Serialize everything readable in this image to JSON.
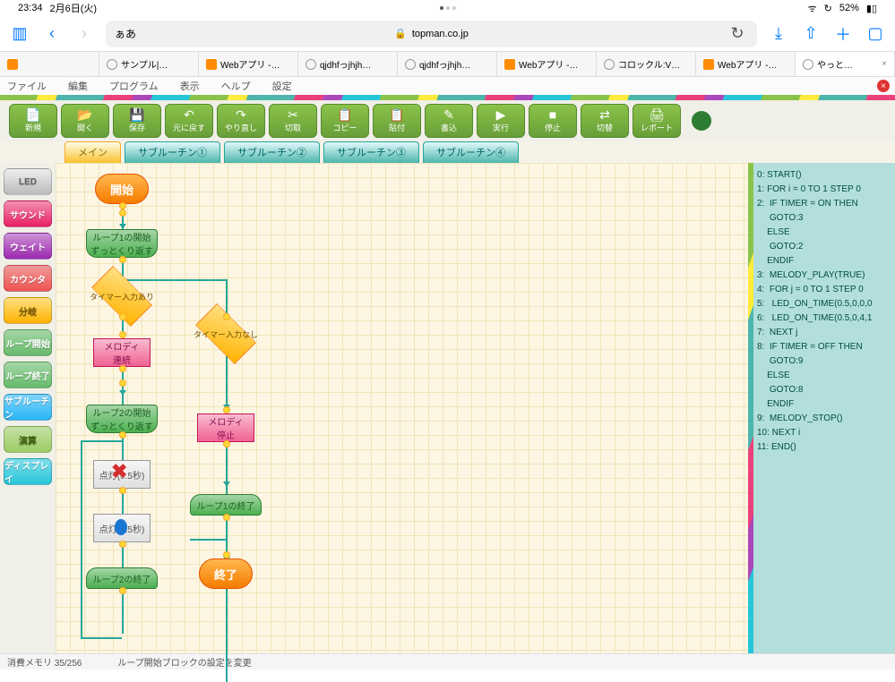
{
  "status": {
    "time": "23:34",
    "date": "2月6日(火)",
    "battery": "52%"
  },
  "safari": {
    "url_left": "ぁあ",
    "domain": "topman.co.jp"
  },
  "browser_tabs": [
    {
      "label": ""
    },
    {
      "label": "サンプル|…"
    },
    {
      "label": "Webアプリ -…"
    },
    {
      "label": "qjdhfっjhjh…"
    },
    {
      "label": "qjdhfっjhjh…"
    },
    {
      "label": "Webアプリ -…"
    },
    {
      "label": "コロックル:V…"
    },
    {
      "label": "Webアプリ -…"
    },
    {
      "label": "やっと…"
    }
  ],
  "menu": [
    "ファイル",
    "編集",
    "プログラム",
    "表示",
    "ヘルプ",
    "設定"
  ],
  "toolbar": [
    {
      "icon": "📄",
      "label": "新規"
    },
    {
      "icon": "📂",
      "label": "開く"
    },
    {
      "icon": "💾",
      "label": "保存"
    },
    {
      "icon": "↶",
      "label": "元に戻す"
    },
    {
      "icon": "↷",
      "label": "やり直し"
    },
    {
      "icon": "✂",
      "label": "切取"
    },
    {
      "icon": "📋",
      "label": "コピー"
    },
    {
      "icon": "📋",
      "label": "貼付"
    },
    {
      "icon": "✎",
      "label": "書込"
    },
    {
      "icon": "▶",
      "label": "実行"
    },
    {
      "icon": "■",
      "label": "停止"
    },
    {
      "icon": "⇄",
      "label": "切替"
    },
    {
      "icon": "🖨",
      "label": "レポート"
    }
  ],
  "app_tabs": [
    "メイン",
    "サブルーチン①",
    "サブルーチン②",
    "サブルーチン③",
    "サブルーチン④"
  ],
  "palette": [
    {
      "cls": "led",
      "label": "LED"
    },
    {
      "cls": "sound",
      "label": "サウンド"
    },
    {
      "cls": "wait",
      "label": "ウェイト"
    },
    {
      "cls": "counter",
      "label": "カウンタ"
    },
    {
      "cls": "branch",
      "label": "分岐"
    },
    {
      "cls": "lstart",
      "label": "ループ開始"
    },
    {
      "cls": "lend",
      "label": "ループ終了"
    },
    {
      "cls": "subr",
      "label": "サブルーチン"
    },
    {
      "cls": "calc",
      "label": "演算"
    },
    {
      "cls": "disp",
      "label": "ディスプレイ"
    }
  ],
  "flow": {
    "start": "開始",
    "end": "終了",
    "loop1_start_l1": "ループ1の開始",
    "loop1_start_l2": "ずっとくり返す",
    "branch_yes": "タイマー入力あり",
    "branch_no": "タイマー入力なし",
    "melody_cont_l1": "メロディ",
    "melody_cont_l2": "連続",
    "loop2_start_l1": "ループ2の開始",
    "loop2_start_l2": "ずっとくり返す",
    "led_on": "点灯(0.5秒)",
    "led_on2": "点灯(0.5秒)",
    "loop2_end": "ループ2の終了",
    "melody_stop_l1": "メロディ",
    "melody_stop_l2": "停止",
    "loop1_end": "ループ1の終了"
  },
  "code": "0: START()\n1: FOR i = 0 TO 1 STEP 0\n2:  IF TIMER = ON THEN\n     GOTO:3\n    ELSE\n     GOTO:2\n    ENDIF\n3:  MELODY_PLAY(TRUE)\n4:  FOR j = 0 TO 1 STEP 0\n5:   LED_ON_TIME(0.5,0,0,0\n6:   LED_ON_TIME(0.5,0,4,1\n7:  NEXT j\n8:  IF TIMER = OFF THEN\n     GOTO:9\n    ELSE\n     GOTO:8\n    ENDIF\n9:  MELODY_STOP()\n10: NEXT i\n11: END()",
  "statusbar": {
    "mem": "消費メモリ 35/256",
    "hint": "ループ開始ブロックの設定を変更"
  }
}
